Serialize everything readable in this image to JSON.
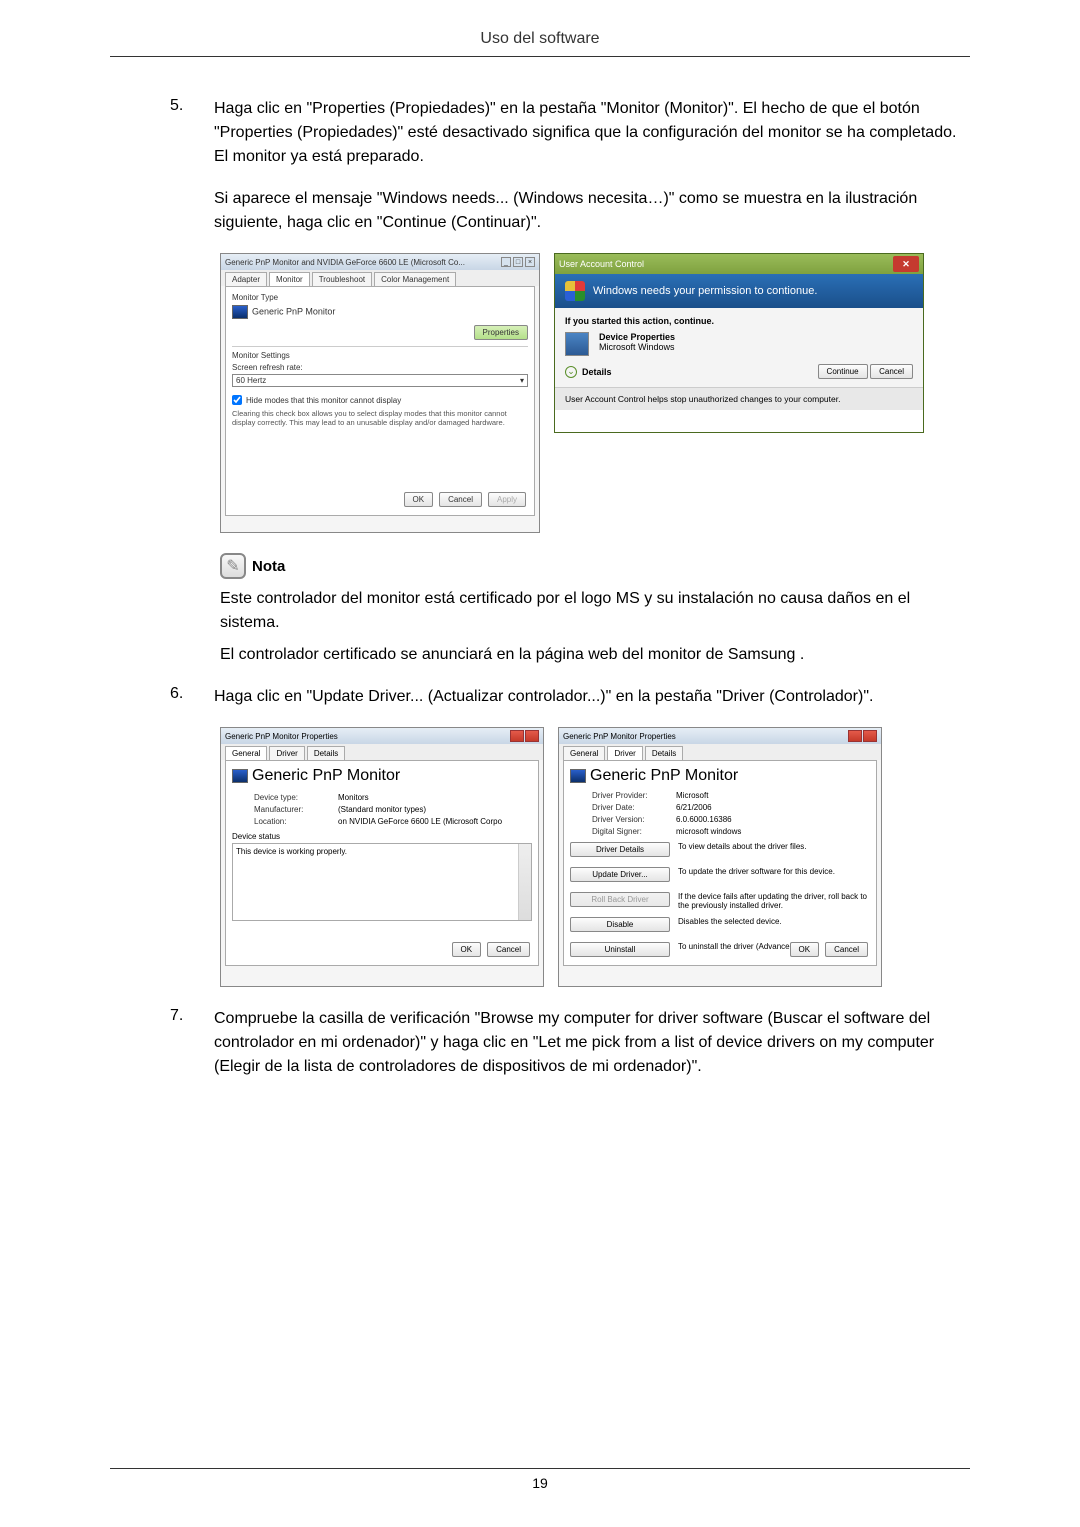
{
  "header": {
    "title": "Uso del software"
  },
  "steps": {
    "s5": {
      "num": "5.",
      "text": "Haga clic en \"Properties (Propiedades)\" en la pestaña \"Monitor (Monitor)\". El hecho de que el botón \"Properties (Propiedades)\" esté desactivado significa que la configuración del monitor se ha completado. El monitor ya está preparado.",
      "para": "Si aparece el mensaje \"Windows needs... (Windows necesita…)\" como se muestra en la ilustración siguiente, haga clic en \"Continue (Continuar)\"."
    },
    "s6": {
      "num": "6.",
      "text": "Haga clic en \"Update Driver... (Actualizar controlador...)\" en la pestaña \"Driver (Controlador)\"."
    },
    "s7": {
      "num": "7.",
      "text": "Compruebe la casilla de verificación \"Browse my computer for driver software (Buscar el software del controlador en mi ordenador)\" y haga clic en \"Let me pick from a list of device drivers on my computer (Elegir de la lista de controladores de dispositivos de mi ordenador)\"."
    }
  },
  "note": {
    "label": "Nota",
    "p1": "Este controlador del monitor está certificado por el logo MS y su instalación no causa daños en el sistema.",
    "p2": "El controlador certificado se anunciará en la página web del monitor de Samsung ."
  },
  "dialog1": {
    "title": "Generic PnP Monitor and NVIDIA GeForce 6600 LE (Microsoft Co...",
    "tabs": {
      "t1": "Adapter",
      "t2": "Monitor",
      "t3": "Troubleshoot",
      "t4": "Color Management"
    },
    "monitorType": "Monitor Type",
    "monitorName": "Generic PnP Monitor",
    "propertiesBtn": "Properties",
    "settingsLabel": "Monitor Settings",
    "refreshLabel": "Screen refresh rate:",
    "refreshValue": "60 Hertz",
    "hideModes": "Hide modes that this monitor cannot display",
    "hideDesc": "Clearing this check box allows you to select display modes that this monitor cannot display correctly. This may lead to an unusable display and/or damaged hardware.",
    "ok": "OK",
    "cancel": "Cancel",
    "apply": "Apply"
  },
  "dialog2": {
    "title": "User Account Control",
    "banner": "Windows needs your permission to contionue.",
    "sub": "If you started this action, continue.",
    "propTitle": "Device Properties",
    "propSub": "Microsoft Windows",
    "details": "Details",
    "continue": "Continue",
    "cancel": "Cancel",
    "footer": "User Account Control helps stop unauthorized changes to your computer."
  },
  "dialog3": {
    "title": "Generic PnP Monitor Properties",
    "tabs": {
      "t1": "General",
      "t2": "Driver",
      "t3": "Details"
    },
    "monitorName": "Generic PnP Monitor",
    "kv": {
      "deviceType": {
        "k": "Device type:",
        "v": "Monitors"
      },
      "manufacturer": {
        "k": "Manufacturer:",
        "v": "(Standard monitor types)"
      },
      "location": {
        "k": "Location:",
        "v": "on NVIDIA GeForce 6600 LE (Microsoft Corpo"
      }
    },
    "statusLabel": "Device status",
    "statusText": "This device is working properly.",
    "ok": "OK",
    "cancel": "Cancel"
  },
  "dialog4": {
    "title": "Generic PnP Monitor Properties",
    "tabs": {
      "t1": "General",
      "t2": "Driver",
      "t3": "Details"
    },
    "monitorName": "Generic PnP Monitor",
    "kv": {
      "provider": {
        "k": "Driver Provider:",
        "v": "Microsoft"
      },
      "date": {
        "k": "Driver Date:",
        "v": "6/21/2006"
      },
      "version": {
        "k": "Driver Version:",
        "v": "6.0.6000.16386"
      },
      "signer": {
        "k": "Digital Signer:",
        "v": "microsoft windows"
      }
    },
    "buttons": {
      "details": {
        "label": "Driver Details",
        "desc": "To view details about the driver files."
      },
      "update": {
        "label": "Update Driver...",
        "desc": "To update the driver software for this device."
      },
      "rollback": {
        "label": "Roll Back Driver",
        "desc": "If the device fails after updating the driver, roll back to the previously installed driver."
      },
      "disable": {
        "label": "Disable",
        "desc": "Disables the selected device."
      },
      "uninstall": {
        "label": "Uninstall",
        "desc": "To uninstall the driver (Advanced)."
      }
    },
    "ok": "OK",
    "cancel": "Cancel"
  },
  "pageNumber": "19"
}
